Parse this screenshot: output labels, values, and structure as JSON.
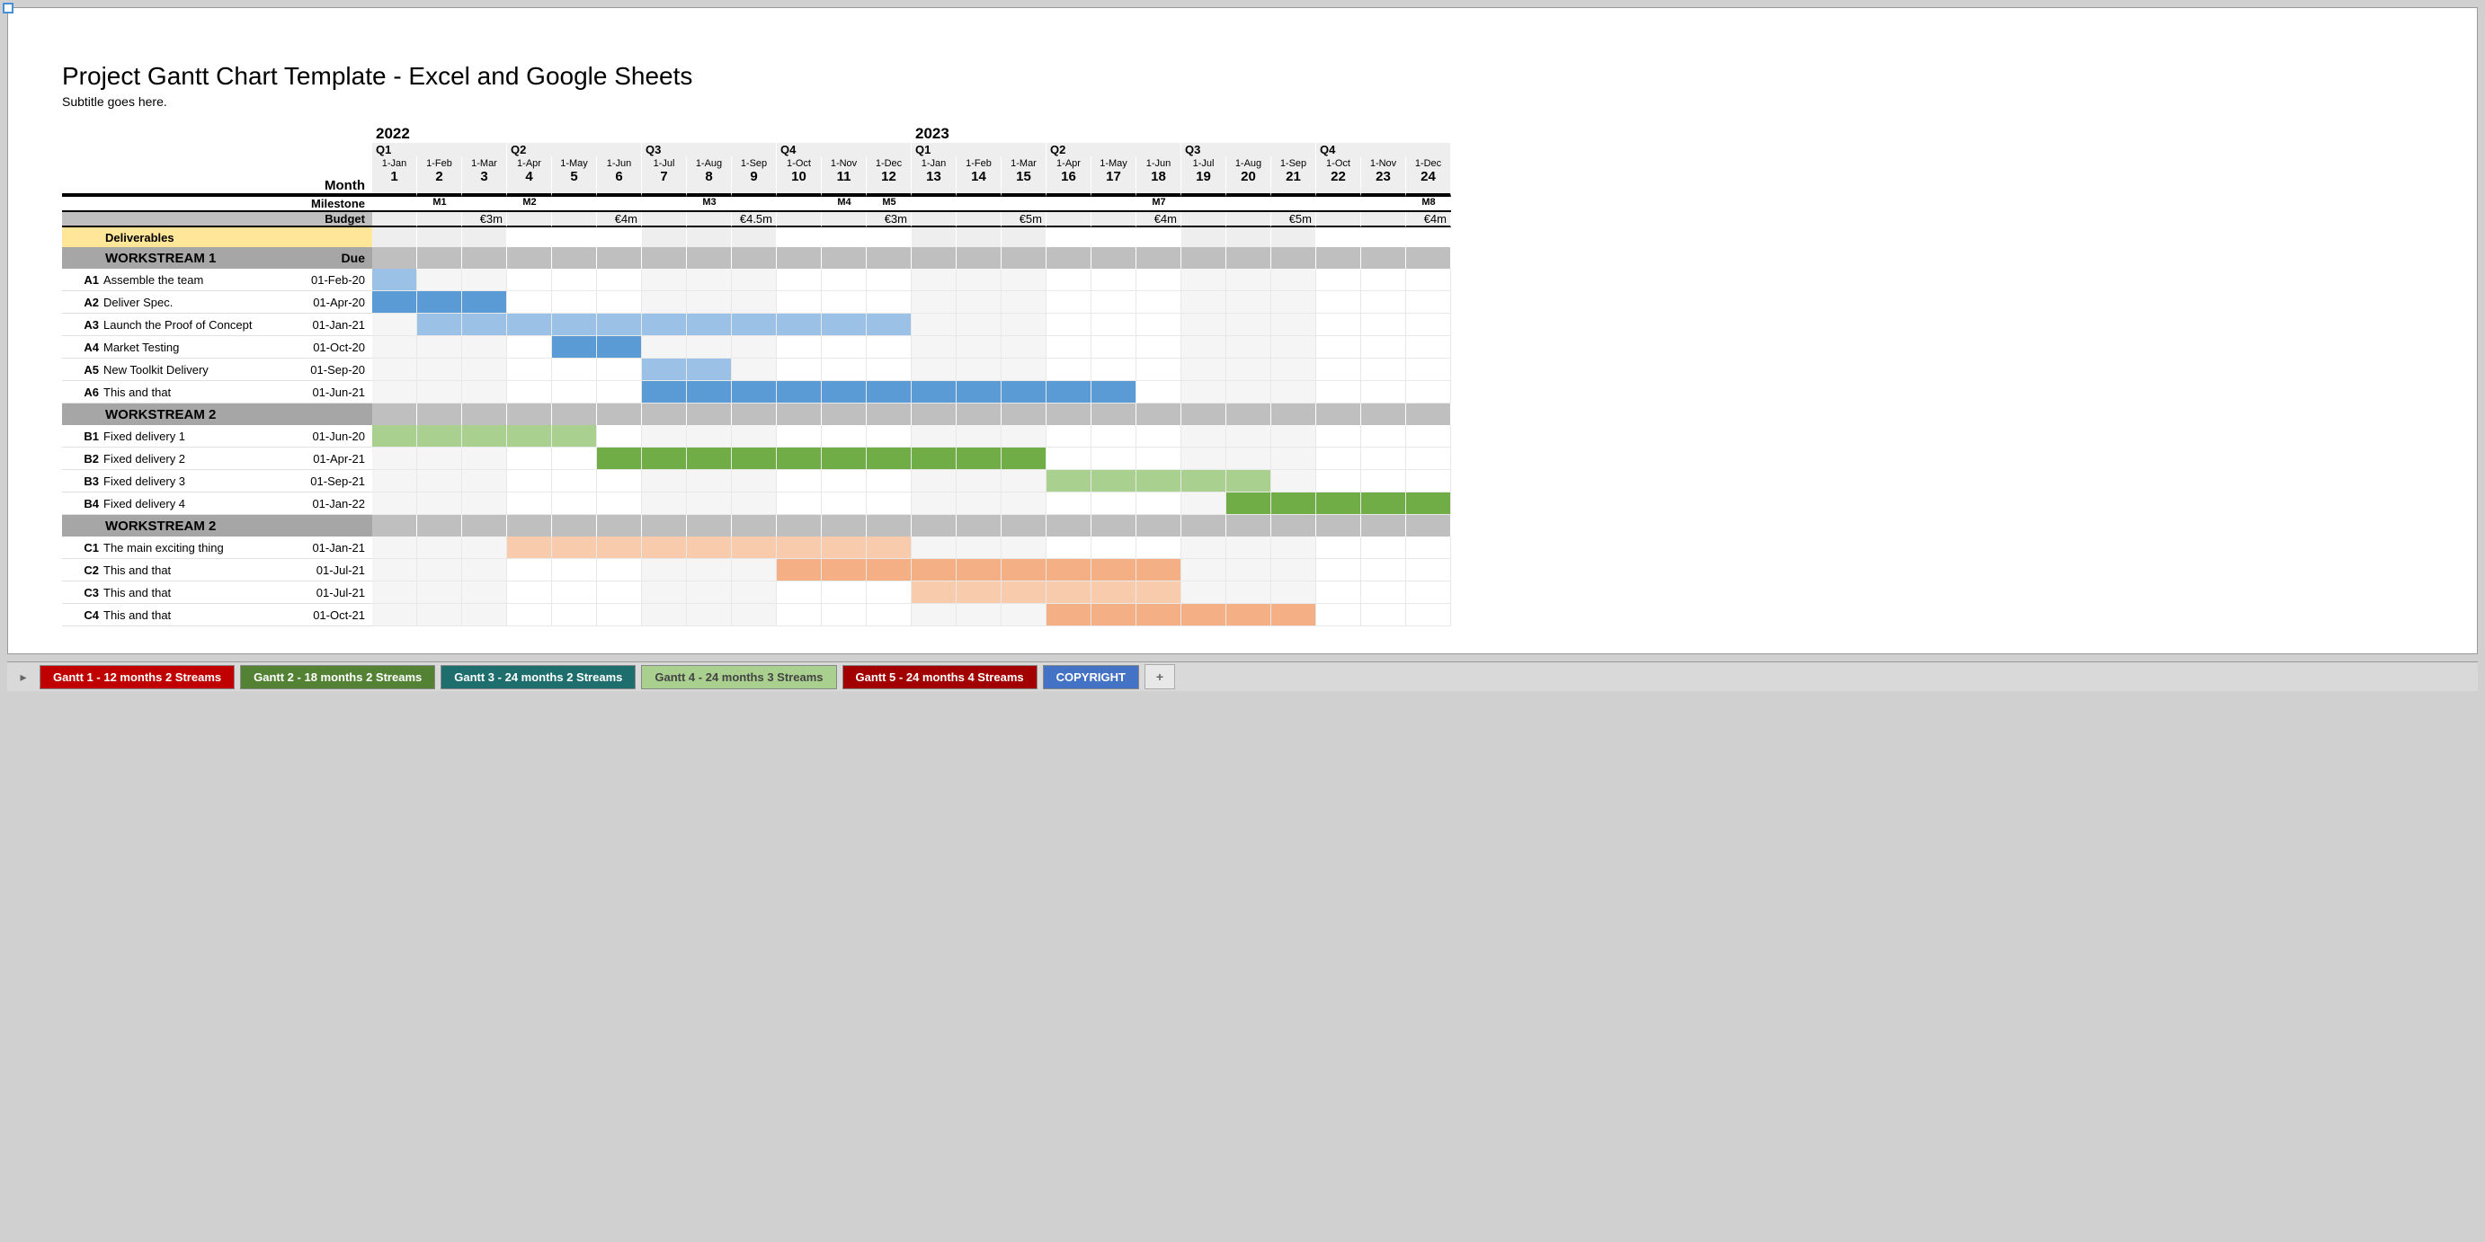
{
  "title": "Project Gantt Chart Template - Excel and Google Sheets",
  "subtitle": "Subtitle goes here.",
  "header": {
    "years": [
      "2022",
      "2023"
    ],
    "quarters": [
      "Q1",
      "Q2",
      "Q3",
      "Q4",
      "Q1",
      "Q2",
      "Q3",
      "Q4"
    ],
    "month_labels": [
      "1-Jan",
      "1-Feb",
      "1-Mar",
      "1-Apr",
      "1-May",
      "1-Jun",
      "1-Jul",
      "1-Aug",
      "1-Sep",
      "1-Oct",
      "1-Nov",
      "1-Dec",
      "1-Jan",
      "1-Feb",
      "1-Mar",
      "1-Apr",
      "1-May",
      "1-Jun",
      "1-Jul",
      "1-Aug",
      "1-Sep",
      "1-Oct",
      "1-Nov",
      "1-Dec"
    ],
    "month_nums": [
      "1",
      "2",
      "3",
      "4",
      "5",
      "6",
      "7",
      "8",
      "9",
      "10",
      "11",
      "12",
      "13",
      "14",
      "15",
      "16",
      "17",
      "18",
      "19",
      "20",
      "21",
      "22",
      "23",
      "24"
    ],
    "month_label": "Month"
  },
  "milestones": {
    "label": "Milestone",
    "vals": [
      "",
      "M1",
      "",
      "M2",
      "",
      "",
      "",
      "M3",
      "",
      "",
      "M4",
      "M5",
      "",
      "",
      "",
      "",
      "",
      "M7",
      "",
      "",
      "",
      "",
      "",
      "M8"
    ]
  },
  "budget": {
    "label": "Budget",
    "vals": [
      "",
      "",
      "€3m",
      "",
      "",
      "€4m",
      "",
      "",
      "€4.5m",
      "",
      "",
      "€3m",
      "",
      "",
      "€5m",
      "",
      "",
      "€4m",
      "",
      "",
      "€5m",
      "",
      "",
      "€4m"
    ]
  },
  "deliverables_label": "Deliverables",
  "workstreams": [
    {
      "name": "WORKSTREAM 1",
      "due_label": "Due",
      "tasks": [
        {
          "id": "A1",
          "name": "Assemble the team",
          "due": "01-Feb-20",
          "bars": [
            {
              "s": 1,
              "e": 1,
              "c": "bar-blue-light"
            }
          ]
        },
        {
          "id": "A2",
          "name": "Deliver Spec.",
          "due": "01-Apr-20",
          "bars": [
            {
              "s": 1,
              "e": 3,
              "c": "bar-blue"
            }
          ]
        },
        {
          "id": "A3",
          "name": "Launch the Proof of Concept",
          "due": "01-Jan-21",
          "bars": [
            {
              "s": 2,
              "e": 12,
              "c": "bar-blue-light"
            }
          ]
        },
        {
          "id": "A4",
          "name": "Market Testing",
          "due": "01-Oct-20",
          "bars": [
            {
              "s": 5,
              "e": 6,
              "c": "bar-blue"
            }
          ]
        },
        {
          "id": "A5",
          "name": "New Toolkit Delivery",
          "due": "01-Sep-20",
          "bars": [
            {
              "s": 7,
              "e": 8,
              "c": "bar-blue-light"
            }
          ]
        },
        {
          "id": "A6",
          "name": "This and that",
          "due": "01-Jun-21",
          "bars": [
            {
              "s": 7,
              "e": 17,
              "c": "bar-blue"
            }
          ]
        }
      ]
    },
    {
      "name": "WORKSTREAM 2",
      "due_label": "",
      "tasks": [
        {
          "id": "B1",
          "name": "Fixed delivery 1",
          "due": "01-Jun-20",
          "bars": [
            {
              "s": 1,
              "e": 5,
              "c": "bar-green-light"
            }
          ]
        },
        {
          "id": "B2",
          "name": "Fixed delivery 2",
          "due": "01-Apr-21",
          "bars": [
            {
              "s": 6,
              "e": 15,
              "c": "bar-green-med"
            }
          ]
        },
        {
          "id": "B3",
          "name": "Fixed delivery 3",
          "due": "01-Sep-21",
          "bars": [
            {
              "s": 16,
              "e": 20,
              "c": "bar-green-light"
            }
          ]
        },
        {
          "id": "B4",
          "name": "Fixed delivery 4",
          "due": "01-Jan-22",
          "bars": [
            {
              "s": 20,
              "e": 24,
              "c": "bar-green-med"
            }
          ]
        }
      ]
    },
    {
      "name": "WORKSTREAM 2",
      "due_label": "",
      "tasks": [
        {
          "id": "C1",
          "name": "The main exciting thing",
          "due": "01-Jan-21",
          "bars": [
            {
              "s": 4,
              "e": 12,
              "c": "bar-orange-light"
            }
          ]
        },
        {
          "id": "C2",
          "name": "This and that",
          "due": "01-Jul-21",
          "bars": [
            {
              "s": 10,
              "e": 18,
              "c": "bar-orange-med"
            }
          ]
        },
        {
          "id": "C3",
          "name": "This and that",
          "due": "01-Jul-21",
          "bars": [
            {
              "s": 13,
              "e": 18,
              "c": "bar-orange-light"
            }
          ]
        },
        {
          "id": "C4",
          "name": "This and that",
          "due": "01-Oct-21",
          "bars": [
            {
              "s": 16,
              "e": 21,
              "c": "bar-orange-med"
            }
          ]
        }
      ]
    }
  ],
  "tabs": [
    {
      "label": "Gantt 1 - 12 months  2 Streams",
      "cls": "tab-red"
    },
    {
      "label": "Gantt 2 - 18 months 2 Streams",
      "cls": "tab-green"
    },
    {
      "label": "Gantt 3 - 24 months 2 Streams",
      "cls": "tab-teal"
    },
    {
      "label": "Gantt 4 - 24 months 3 Streams",
      "cls": "tab-ltgreen"
    },
    {
      "label": "Gantt 5 - 24 months 4 Streams",
      "cls": "tab-dred"
    },
    {
      "label": "COPYRIGHT",
      "cls": "tab-blue"
    }
  ],
  "chart_data": {
    "type": "gantt",
    "title": "Project Gantt Chart Template - Excel and Google Sheets",
    "x_axis": {
      "unit": "month",
      "start": "2022-01",
      "end": "2023-12",
      "count": 24
    },
    "milestones": [
      {
        "m": 2,
        "label": "M1"
      },
      {
        "m": 4,
        "label": "M2"
      },
      {
        "m": 8,
        "label": "M3"
      },
      {
        "m": 11,
        "label": "M4"
      },
      {
        "m": 12,
        "label": "M5"
      },
      {
        "m": 18,
        "label": "M7"
      },
      {
        "m": 24,
        "label": "M8"
      }
    ],
    "budget_per_quarter": [
      "€3m",
      "€4m",
      "€4.5m",
      "€3m",
      "€5m",
      "€4m",
      "€5m",
      "€4m"
    ],
    "series": [
      {
        "group": "WORKSTREAM 1",
        "id": "A1",
        "name": "Assemble the team",
        "due": "01-Feb-20",
        "start": 1,
        "end": 1
      },
      {
        "group": "WORKSTREAM 1",
        "id": "A2",
        "name": "Deliver Spec.",
        "due": "01-Apr-20",
        "start": 1,
        "end": 3
      },
      {
        "group": "WORKSTREAM 1",
        "id": "A3",
        "name": "Launch the Proof of Concept",
        "due": "01-Jan-21",
        "start": 2,
        "end": 12
      },
      {
        "group": "WORKSTREAM 1",
        "id": "A4",
        "name": "Market Testing",
        "due": "01-Oct-20",
        "start": 5,
        "end": 6
      },
      {
        "group": "WORKSTREAM 1",
        "id": "A5",
        "name": "New Toolkit Delivery",
        "due": "01-Sep-20",
        "start": 7,
        "end": 8
      },
      {
        "group": "WORKSTREAM 1",
        "id": "A6",
        "name": "This and that",
        "due": "01-Jun-21",
        "start": 7,
        "end": 17
      },
      {
        "group": "WORKSTREAM 2",
        "id": "B1",
        "name": "Fixed delivery 1",
        "due": "01-Jun-20",
        "start": 1,
        "end": 5
      },
      {
        "group": "WORKSTREAM 2",
        "id": "B2",
        "name": "Fixed delivery 2",
        "due": "01-Apr-21",
        "start": 6,
        "end": 15
      },
      {
        "group": "WORKSTREAM 2",
        "id": "B3",
        "name": "Fixed delivery 3",
        "due": "01-Sep-21",
        "start": 16,
        "end": 20
      },
      {
        "group": "WORKSTREAM 2",
        "id": "B4",
        "name": "Fixed delivery 4",
        "due": "01-Jan-22",
        "start": 20,
        "end": 24
      },
      {
        "group": "WORKSTREAM 2b",
        "id": "C1",
        "name": "The main exciting thing",
        "due": "01-Jan-21",
        "start": 4,
        "end": 12
      },
      {
        "group": "WORKSTREAM 2b",
        "id": "C2",
        "name": "This and that",
        "due": "01-Jul-21",
        "start": 10,
        "end": 18
      },
      {
        "group": "WORKSTREAM 2b",
        "id": "C3",
        "name": "This and that",
        "due": "01-Jul-21",
        "start": 13,
        "end": 18
      },
      {
        "group": "WORKSTREAM 2b",
        "id": "C4",
        "name": "This and that",
        "due": "01-Oct-21",
        "start": 16,
        "end": 21
      }
    ]
  }
}
